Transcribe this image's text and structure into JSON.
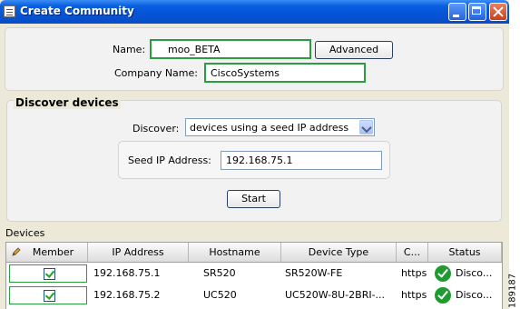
{
  "window": {
    "title": "Create Community"
  },
  "community": {
    "name_label": "Name:",
    "name_value": "moo_BETA",
    "advanced_label": "Advanced",
    "company_label": "Company Name:",
    "company_value": "CiscoSystems"
  },
  "discover": {
    "section_title": "Discover devices",
    "discover_label": "Discover:",
    "discover_value": "devices using a seed IP address",
    "seed_label": "Seed IP Address:",
    "seed_value": "192.168.75.1",
    "start_label": "Start"
  },
  "devices": {
    "section_title": "Devices",
    "columns": [
      "Member",
      "IP Address",
      "Hostname",
      "Device Type",
      "C...",
      "Status"
    ],
    "rows": [
      {
        "member": true,
        "ip": "192.168.75.1",
        "hostname": "SR520",
        "device_type": "SR520W-FE",
        "c": "https",
        "status": "Disco..."
      },
      {
        "member": true,
        "ip": "192.168.75.2",
        "hostname": "UC520",
        "device_type": "UC520W-8U-2BRI-...",
        "c": "https",
        "status": "Disco..."
      }
    ]
  },
  "figure_id": "189187",
  "colors": {
    "title_blue": "#0454d8",
    "field_border_green": "#2b9c3f",
    "status_ok": "#1f9a2e"
  },
  "icons": [
    "window-app-icon",
    "minimize-icon",
    "maximize-icon",
    "close-icon",
    "chevron-down-icon",
    "pencil-icon",
    "checkbox-checked-icon",
    "status-ok-icon"
  ]
}
